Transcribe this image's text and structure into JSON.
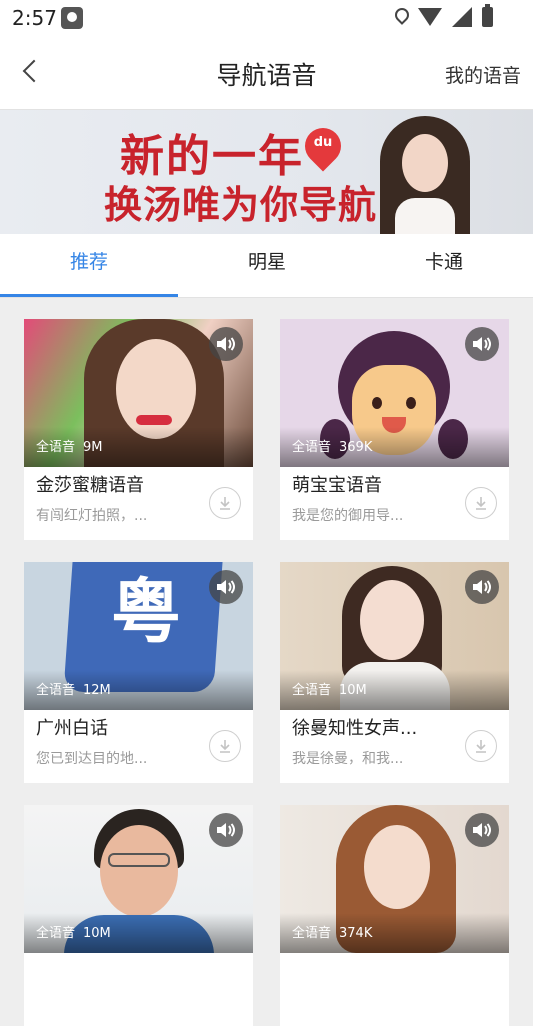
{
  "status_bar": {
    "time": "2:57"
  },
  "nav": {
    "title": "导航语音",
    "right_label": "我的语音"
  },
  "banner": {
    "line1": "新的一年",
    "line2": "换汤唯为你导航",
    "logo": "du"
  },
  "tabs": [
    {
      "label": "推荐",
      "active": true
    },
    {
      "label": "明星",
      "active": false
    },
    {
      "label": "卡通",
      "active": false
    }
  ],
  "cards": [
    {
      "title": "金莎蜜糖语音",
      "subtitle": "有闯红灯拍照，...",
      "type": "全语音",
      "size": "9M"
    },
    {
      "title": "萌宝宝语音",
      "subtitle": "我是您的御用导...",
      "type": "全语音",
      "size": "369K"
    },
    {
      "title": "广州白话",
      "subtitle": "您已到达目的地...",
      "type": "全语音",
      "size": "12M",
      "badge_text": "粤"
    },
    {
      "title": "徐曼知性女声...",
      "subtitle": "我是徐曼，和我...",
      "type": "全语音",
      "size": "10M"
    },
    {
      "title": "",
      "subtitle": "",
      "type": "全语音",
      "size": "10M"
    },
    {
      "title": "",
      "subtitle": "",
      "type": "全语音",
      "size": "374K"
    }
  ],
  "colors": {
    "accent": "#3585e6",
    "banner_red": "#c8232c"
  }
}
